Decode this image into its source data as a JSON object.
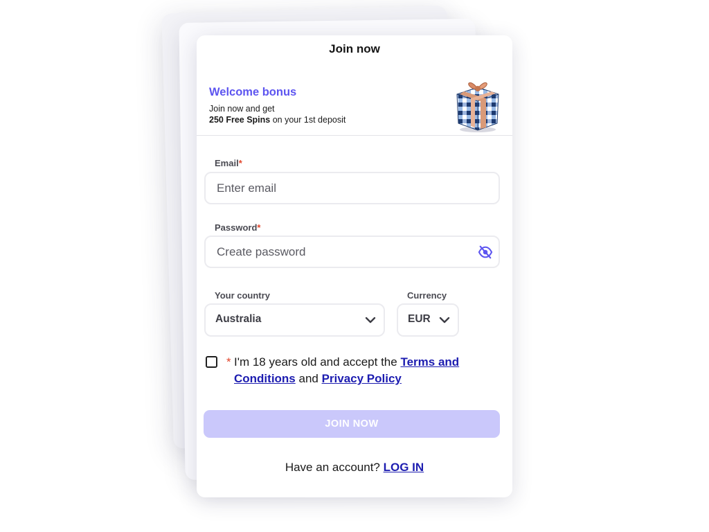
{
  "dialog": {
    "title": "Join now"
  },
  "bonus": {
    "title": "Welcome bonus",
    "line1": "Join now and get",
    "highlight": "250 Free Spins",
    "line2_rest": " on your 1st deposit",
    "icon": "gift-box-icon"
  },
  "form": {
    "email": {
      "label": "Email",
      "required_mark": "*",
      "placeholder": "Enter email",
      "value": ""
    },
    "password": {
      "label": "Password",
      "required_mark": "*",
      "placeholder": "Create password",
      "value": "",
      "toggle_icon": "eye-slash-icon"
    },
    "country": {
      "label": "Your country",
      "selected": "Australia",
      "icon": "chevron-down-icon"
    },
    "currency": {
      "label": "Currency",
      "selected": "EUR",
      "icon": "chevron-down-icon"
    },
    "terms": {
      "checked": false,
      "required_mark": "*",
      "text_before": "I'm 18 years old and accept the ",
      "terms_link": "Terms and Conditions",
      "text_middle": " and ",
      "privacy_link": "Privacy Policy"
    },
    "submit_label": "JOIN NOW"
  },
  "footer": {
    "prompt": "Have an account? ",
    "login_link": "LOG IN"
  },
  "colors": {
    "accent": "#5d55f0",
    "button_disabled": "#cac8fb",
    "link": "#1c1cb0",
    "required": "#e2462c"
  }
}
